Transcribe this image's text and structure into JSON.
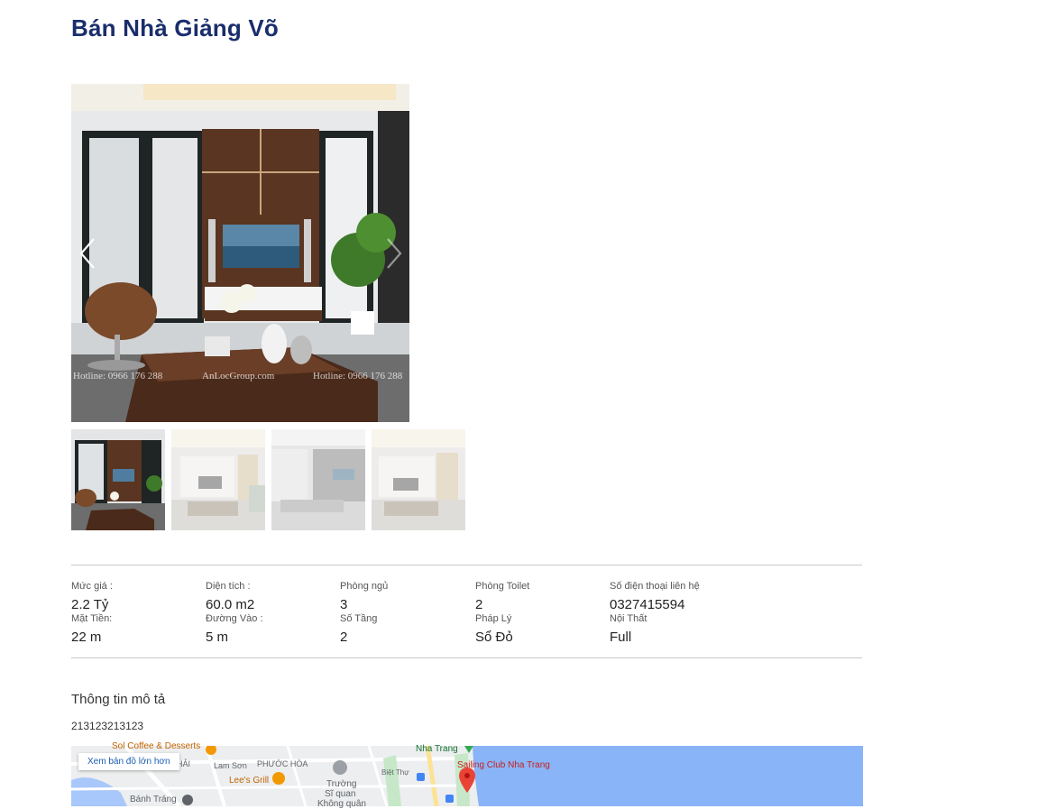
{
  "page": {
    "title": "Bán Nhà Giảng Võ"
  },
  "gallery": {
    "watermark_left": "Hotline: 0966 176 288",
    "watermark_center": "AnLocGroup.com",
    "watermark_right": "Hotline: 0966 176 288",
    "thumbnail_count": 4
  },
  "specs": [
    {
      "label": "Mức giá :",
      "value": "2.2 Tỷ"
    },
    {
      "label": "Diện tích :",
      "value": "60.0 m2"
    },
    {
      "label": "Phòng ngủ",
      "value": "3"
    },
    {
      "label": "Phòng Toilet",
      "value": "2"
    },
    {
      "label": "Số điện thoại liên hệ",
      "value": "0327415594"
    },
    {
      "label": "Mặt Tiền:",
      "value": "22 m"
    },
    {
      "label": "Đường Vào :",
      "value": "5 m"
    },
    {
      "label": "Số Tầng",
      "value": "2"
    },
    {
      "label": "Pháp Lý",
      "value": "Sổ Đỏ"
    },
    {
      "label": "Nội Thất",
      "value": "Full"
    }
  ],
  "description": {
    "heading": "Thông tin mô tả",
    "text": "213123213123"
  },
  "map": {
    "view_larger_link": "Xem bản đồ lớn hơn",
    "labels": {
      "coffee": "Sol Coffee & Desserts",
      "phuoc_hai": "C HẢI",
      "lam_son": "Lam Sơn",
      "phuoc_hoa": "PHƯỚC HÒA",
      "lees_grill": "Lee's Grill",
      "truong": "Trường",
      "si_quan": "Sĩ quan",
      "khong_quan": "Không quân",
      "banh_trang": "Bánh Tráng",
      "nha_trang": "Nha Trang",
      "sailing_club": "Sailing Club Nha Trang",
      "biet_thu": "Biệt Thự"
    }
  },
  "colors": {
    "title": "#1a2e6c",
    "link": "#1a5fb4",
    "sea": "#8ab4f8",
    "pin": "#ea4335"
  }
}
